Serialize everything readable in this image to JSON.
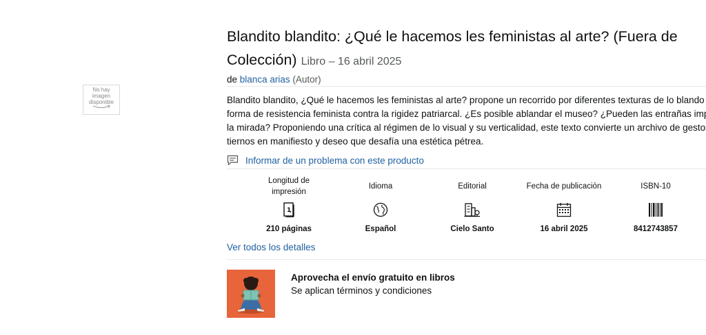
{
  "image_placeholder": {
    "lines": [
      "No hay",
      "imagen",
      "disponible"
    ]
  },
  "product": {
    "title_line1": "Blandito blandito: ¿Qué le hacemos les feministas al arte? (Fuera de",
    "title_line2": "Colección)",
    "format_date": "Libro – 16 abril 2025",
    "by_prefix": "de",
    "author": "blanca arias",
    "author_role": "(Autor)"
  },
  "description": [
    "Blandito blandito, ¿Qué le hacemos les feministas al arte? propone un recorrido por diferentes texturas de lo blando co",
    "forma de resistencia feminista contra la rigidez patriarcal. ¿Es posible ablandar el museo? ¿Pueden las entrañas impone",
    "la mirada? Proponiendo una crítica al régimen de lo visual y su verticalidad, este texto convierte un archivo de gestos",
    "tiernos en manifiesto y deseo que desafía una estética pétrea."
  ],
  "report_link": "Informar de un problema con este producto",
  "attributes": [
    {
      "label": "Longitud de impresión",
      "value": "210 páginas",
      "icon": "book-pages-icon"
    },
    {
      "label": "Idioma",
      "value": "Español",
      "icon": "globe-icon"
    },
    {
      "label": "Editorial",
      "value": "Cielo Santo",
      "icon": "publisher-building-icon"
    },
    {
      "label": "Fecha de publicación",
      "value": "16 abril 2025",
      "icon": "calendar-icon"
    },
    {
      "label": "ISBN-10",
      "value": "8412743857",
      "icon": "barcode-icon"
    }
  ],
  "details_link": "Ver todos los detalles",
  "promo": {
    "headline": "Aprovecha el envío gratuito en libros",
    "subline": "Se aplican términos y condiciones"
  },
  "colors": {
    "link": "#2162a1",
    "promo_bg": "#e8643a"
  }
}
